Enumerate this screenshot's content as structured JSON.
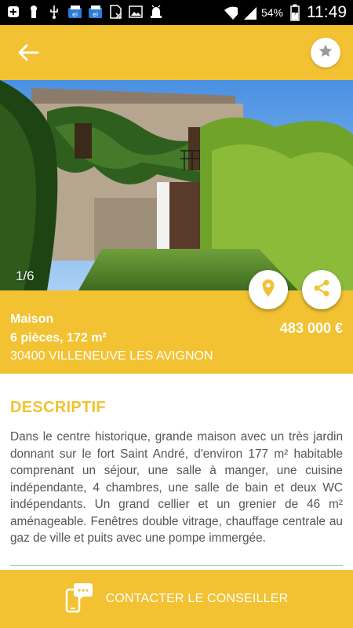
{
  "status_bar": {
    "icons": [
      "plus-box-icon",
      "keyhole-icon",
      "usb-icon",
      "app-ei-icon",
      "app-ei-icon",
      "sim-off-icon",
      "image-icon",
      "android-debug-icon",
      "wifi-icon",
      "signal-icon",
      "battery-charging-icon"
    ],
    "battery": "54%",
    "time": "11:49"
  },
  "appbar": {
    "back_icon": "arrow-back-icon",
    "favorite_icon": "star-icon"
  },
  "gallery": {
    "counter": "1/6"
  },
  "actions": {
    "location_icon": "map-pin-icon",
    "share_icon": "share-icon"
  },
  "listing": {
    "type": "Maison",
    "rooms_area": "6 pièces, 172 m²",
    "address": "30400 VILLENEUVE LES AVIGNON",
    "price": "483 000 €"
  },
  "description": {
    "title": "DESCRIPTIF",
    "text": "Dans le centre historique, grande maison avec un très jardin donnant sur le fort Saint André, d'environ 177 m² habitable comprenant un séjour, une salle à manger, une cuisine indépendante, 4 chambres, une salle de bain et deux WC indépendants. Un grand cellier et un grenier de 46 m² aménageable. Fenêtres double vitrage, chauffage centrale au gaz de ville et puits avec une pompe immergée."
  },
  "contact": {
    "label": "CONTACTER LE CONSEILLER",
    "icon": "phone-chat-icon"
  },
  "colors": {
    "accent": "#f2c232",
    "text": "#555555",
    "surface": "#ffffff"
  }
}
